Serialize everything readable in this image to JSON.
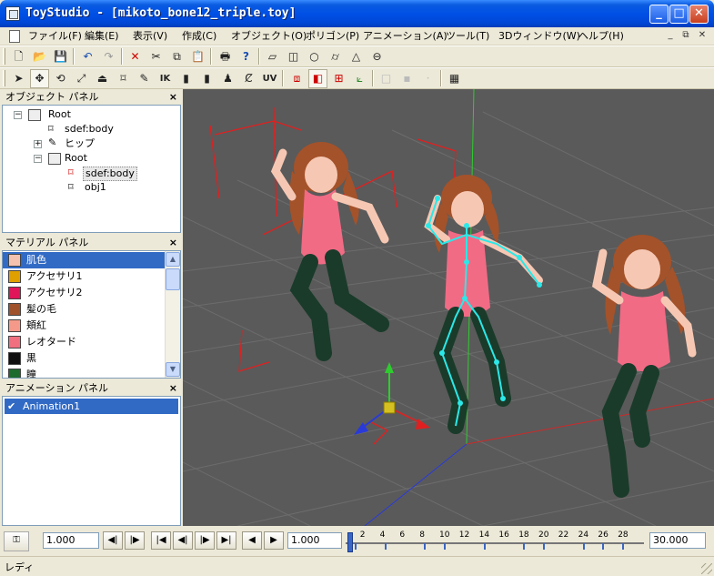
{
  "window": {
    "title": "ToyStudio - [mikoto_bone12_triple.toy]",
    "minimize": "_",
    "maximize": "□",
    "close": "✕"
  },
  "menu": {
    "items": [
      "ファイル(F)",
      "編集(E)",
      "表示(V)",
      "作成(C)",
      "オブジェクト(O)",
      "ポリゴン(P)",
      "アニメーション(A)",
      "ツール(T)",
      "3Dウィンドウ(W)",
      "ヘルプ(H)"
    ],
    "mdi_minimize": "_",
    "mdi_restore": "⧉",
    "mdi_close": "✕"
  },
  "toolbar": {
    "ik_label": "IK",
    "uv_label": "UV"
  },
  "object_panel": {
    "title": "オブジェクト パネル",
    "close": "×",
    "tree": [
      {
        "label": "Root",
        "toggle": "−"
      },
      {
        "label": "sdef:body",
        "toggle": ""
      },
      {
        "label": "ヒップ",
        "toggle": "+"
      },
      {
        "label": "Root",
        "toggle": "−"
      },
      {
        "label": "sdef:body",
        "toggle": "",
        "selected": true
      },
      {
        "label": "obj1",
        "toggle": ""
      }
    ]
  },
  "material_panel": {
    "title": "マテリアル パネル",
    "close": "×",
    "items": [
      {
        "label": "肌色",
        "color": "#F6C2B0",
        "selected": true
      },
      {
        "label": "アクセサリ1",
        "color": "#E0A000"
      },
      {
        "label": "アクセサリ2",
        "color": "#E0155A"
      },
      {
        "label": "髪の毛",
        "color": "#A0522D"
      },
      {
        "label": "頬紅",
        "color": "#F59A8A"
      },
      {
        "label": "レオタード",
        "color": "#F07080"
      },
      {
        "label": "黒",
        "color": "#101010"
      },
      {
        "label": "瞳",
        "color": "#1E6B2E"
      }
    ]
  },
  "animation_panel": {
    "title": "アニメーション パネル",
    "close": "×",
    "items": [
      {
        "label": "Animation1",
        "checked": "✔"
      }
    ]
  },
  "timeline": {
    "speed": "1.000",
    "current_frame": "1.000",
    "end_frame": "30.000",
    "ticks": [
      "2",
      "4",
      "6",
      "8",
      "10",
      "12",
      "14",
      "16",
      "18",
      "20",
      "22",
      "24",
      "26",
      "28"
    ],
    "keyframes": [
      1,
      4,
      8,
      10,
      14,
      18,
      20,
      24,
      26,
      28
    ]
  },
  "status": {
    "text": "レディ"
  },
  "colors": {
    "selection": "#316AC5",
    "viewport_bg": "#5A5A5A",
    "bone": "#2BE8E8"
  }
}
